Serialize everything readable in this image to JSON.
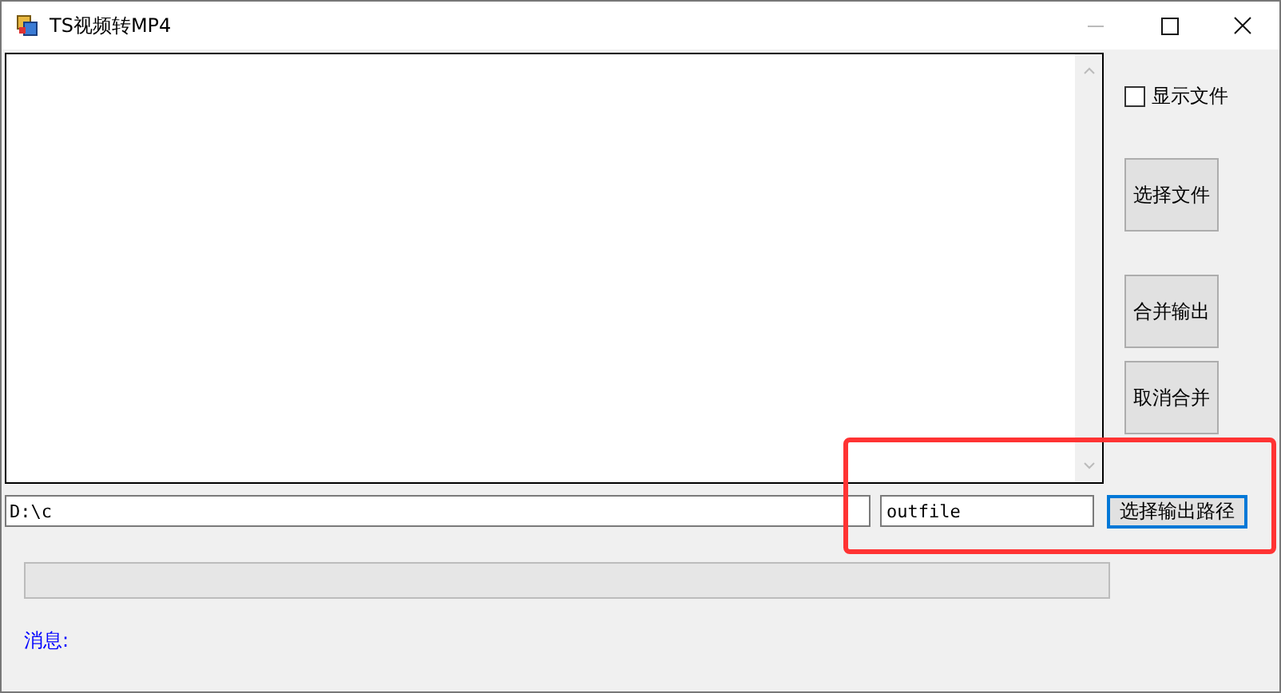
{
  "window": {
    "title": "TS视频转MP4"
  },
  "show_files": {
    "label": "显示文件",
    "checked": false
  },
  "side_buttons": [
    "选择文件",
    "合并输出",
    "取消合并"
  ],
  "input_path": {
    "value": "D:\\c"
  },
  "output_name": {
    "value": "outfile"
  },
  "output_button": {
    "label": "选择输出路径",
    "focused": true
  },
  "progress": {
    "level": 0
  },
  "message": {
    "label": "消息:"
  },
  "highlight": {
    "shown": true
  }
}
